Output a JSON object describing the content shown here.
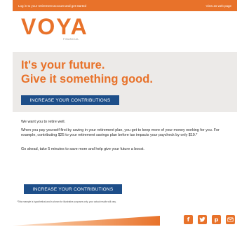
{
  "header": {
    "view_online_link": "Log in to your retirement account and get started",
    "view_web_link": "View as web page"
  },
  "logo": {
    "brand": "VOYA",
    "tagline": "FINANCIAL"
  },
  "hero": {
    "title_line1": "It's your future.",
    "title_line2": "Give it something good.",
    "cta_label": "INCREASE YOUR CONTRIBUTIONS"
  },
  "body": {
    "greeting": "We want you to retire well.",
    "paragraph1": "When you pay yourself first by saving in your retirement plan, you get to keep more of your money working for you. For example, contributing $25 to your retirement savings plan before tax impacts your paycheck by only $19.*",
    "paragraph2": "Go ahead, take 5 minutes to save more and help give your future a boost.",
    "cta_label": "INCREASE YOUR CONTRIBUTIONS"
  },
  "footnote": "*This example is hypothetical and is shown for illustrative purposes only; your actual results will vary.",
  "footer": {
    "social": [
      {
        "name": "facebook-icon",
        "glyph": "f"
      },
      {
        "name": "twitter-icon",
        "glyph": "t"
      },
      {
        "name": "pinterest-icon",
        "glyph": "p"
      },
      {
        "name": "email-icon",
        "glyph": ""
      }
    ]
  },
  "colors": {
    "accent": "#e8722a",
    "button": "#1d4e89",
    "hero_bg": "#eceae8"
  }
}
